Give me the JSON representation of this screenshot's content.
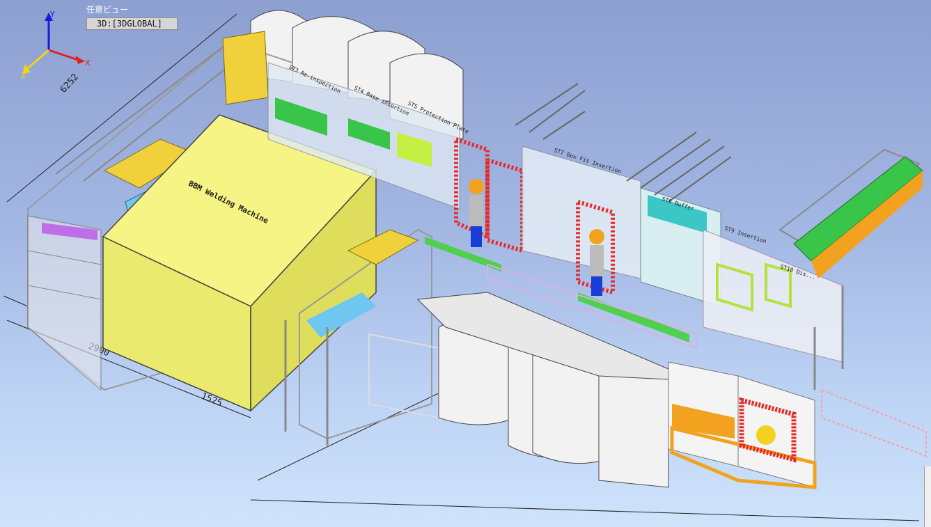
{
  "viewport": {
    "view_label": "任意ビュー",
    "view_name": "3D:[3DGLOBAL]"
  },
  "axes": {
    "x": "X",
    "y": "Y",
    "z": "Z"
  },
  "dimensions": {
    "d1": "6252",
    "d2": "2900",
    "d3": "1525"
  },
  "machine_label": "BBM Welding Machine",
  "station_labels": {
    "st_a": "ST3 Re-inspection",
    "st_b": "ST4 Base insertion",
    "st_c": "ST5 Protection Plate",
    "st_d": "ST7 Box Fit Insertion",
    "st_e": "ST8 Buffer",
    "st_f": "ST9 Insertion",
    "st_g": "ST10 Dis..."
  },
  "colors": {
    "bg_top": "#8d9fd0",
    "bg_bottom": "#cfe3fb",
    "machine": "#f4f27a",
    "frame": "#b8b8b8",
    "accent_green": "#2fbf3a",
    "accent_red": "#e62a2a",
    "accent_orange": "#f2a21e"
  }
}
